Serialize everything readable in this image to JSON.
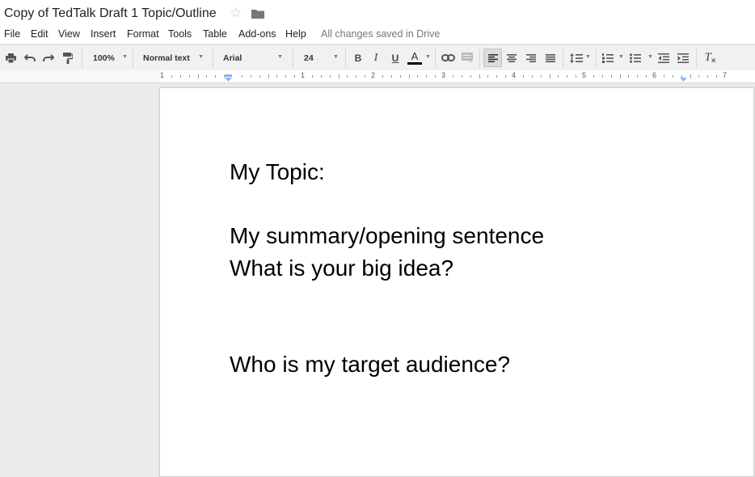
{
  "document": {
    "title": "Copy of TedTalk Draft 1 Topic/Outline",
    "lines": [
      "My Topic:",
      "My summary/opening sentence",
      "What is your big idea?",
      "Who is my target audience?"
    ]
  },
  "menu": {
    "items": [
      "File",
      "Edit",
      "View",
      "Insert",
      "Format",
      "Tools",
      "Table",
      "Add-ons",
      "Help"
    ],
    "save_status": "All changes saved in Drive"
  },
  "toolbar": {
    "zoom": "100%",
    "style": "Normal text",
    "font": "Arial",
    "font_size": "24",
    "bold": "B",
    "italic": "I",
    "underline": "U",
    "text_color": "A",
    "clear_formatting": "T"
  },
  "ruler": {
    "numbers": [
      "1",
      "1",
      "2",
      "3",
      "4",
      "5",
      "6",
      "7"
    ]
  },
  "icons": {
    "star": "star-icon",
    "folder": "folder-icon",
    "print": "print-icon",
    "undo": "undo-icon",
    "redo": "redo-icon",
    "paint_format": "paint-format-icon",
    "link": "link-icon",
    "comment": "comment-icon",
    "align_left": "align-left-icon",
    "align_center": "align-center-icon",
    "align_right": "align-right-icon",
    "align_justify": "align-justify-icon",
    "line_spacing": "line-spacing-icon",
    "numbered_list": "numbered-list-icon",
    "bulleted_list": "bulleted-list-icon",
    "decrease_indent": "decrease-indent-icon",
    "increase_indent": "increase-indent-icon"
  },
  "colors": {
    "text_color_bar": "#000000",
    "indent_marker": "#8ab4f8"
  }
}
